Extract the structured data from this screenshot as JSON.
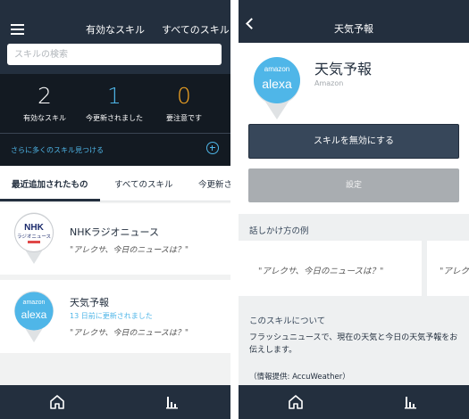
{
  "left": {
    "header": {
      "menu_icon": "hamburger-menu-icon",
      "enabled_skills_link": "有効なスキル",
      "all_skills_link": "すべてのスキル"
    },
    "search": {
      "placeholder": "スキルの検索",
      "value": ""
    },
    "stats": [
      {
        "value": "2",
        "label": "有効なスキル",
        "color": "#ffffff"
      },
      {
        "value": "1",
        "label": "今更新されました",
        "color": "#4fb6e8"
      },
      {
        "value": "0",
        "label": "要注意です",
        "color": "#f5a623"
      }
    ],
    "more_link": "さらに多くのスキル見つける",
    "tabs": [
      "最近追加されたもの",
      "すべてのスキル",
      "今更新さ"
    ],
    "cards": [
      {
        "icon": "nhk-radio-news-icon",
        "icon_text_1": "NHK",
        "icon_text_2": "ラジオニュース",
        "title": "NHKラジオニュース",
        "phrase": "\"アレクサ、今日のニュースは？\""
      },
      {
        "icon": "amazon-alexa-weather-icon",
        "icon_text_1": "amazon",
        "icon_text_2": "alexa",
        "title": "天気予報",
        "updated": "13 日前に更新されました",
        "phrase": "\"アレクサ、今日のニュースは？\""
      }
    ],
    "navbar": {
      "home_icon": "home-icon",
      "stats_icon": "bar-chart-icon"
    }
  },
  "right": {
    "header": {
      "back_icon": "back-chevron-icon",
      "title": "天気予報"
    },
    "skill": {
      "icon_text_1": "amazon",
      "icon_text_2": "alexa",
      "name": "天気予報",
      "publisher": "Amazon"
    },
    "disable_button": "スキルを無効にする",
    "settings_button": "設定",
    "examples_heading": "話しかけ方の例",
    "examples": [
      "\"アレクサ、今日のニュースは？\"",
      "\"アレク"
    ],
    "about_heading": "このスキルについて",
    "about_text": "フラッシュニュースで、現在の天気と今日の天気予報をお伝えします。",
    "credit": "（情報提供: AccuWeather）",
    "navbar": {
      "home_icon": "home-icon",
      "stats_icon": "bar-chart-icon"
    }
  },
  "colors": {
    "header": "#232f3e",
    "stats_bg": "#131a22",
    "accent_blue": "#4fb6e8",
    "warning_orange": "#f5a623"
  }
}
